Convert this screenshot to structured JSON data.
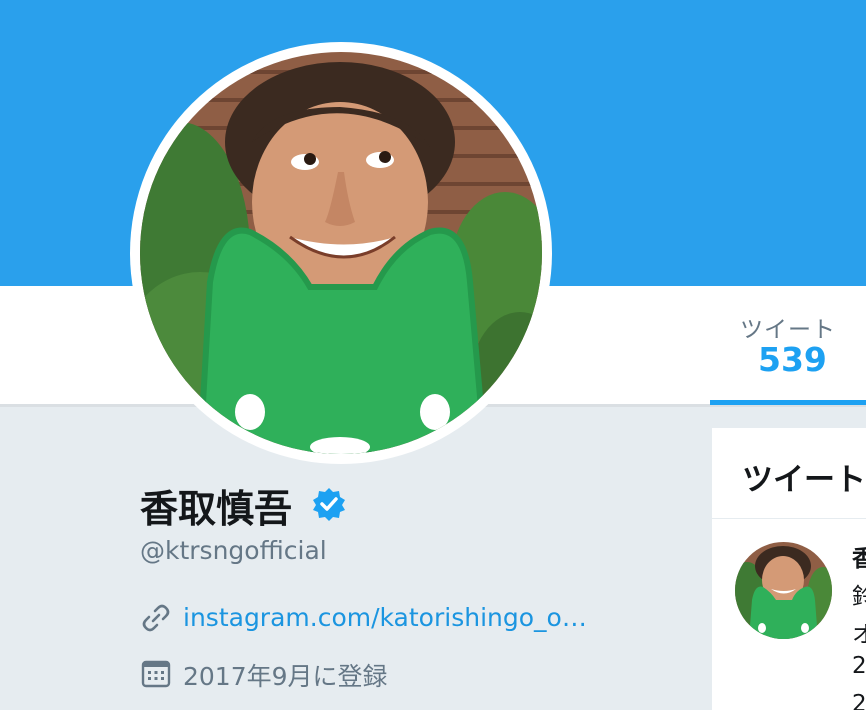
{
  "header": {
    "banner_color": "#2aa0ec"
  },
  "nav": {
    "tabs": [
      {
        "label": "ツイート",
        "count": "539"
      }
    ]
  },
  "profile": {
    "name": "香取慎吾",
    "handle": "@ktrsngofficial",
    "verified": true,
    "link_text": "instagram.com/katorishingo_o…",
    "joined": "2017年9月に登録",
    "avatar_icon": "profile-photo"
  },
  "timeline": {
    "title": "ツイート",
    "tweet": {
      "line1": "香",
      "line2": "鈴",
      "line3": "オ",
      "line4": "2",
      "line5": "2"
    }
  },
  "colors": {
    "accent": "#1da1f2",
    "link": "#1b95e0",
    "text_secondary": "#657786",
    "background": "#e6ecf0"
  }
}
